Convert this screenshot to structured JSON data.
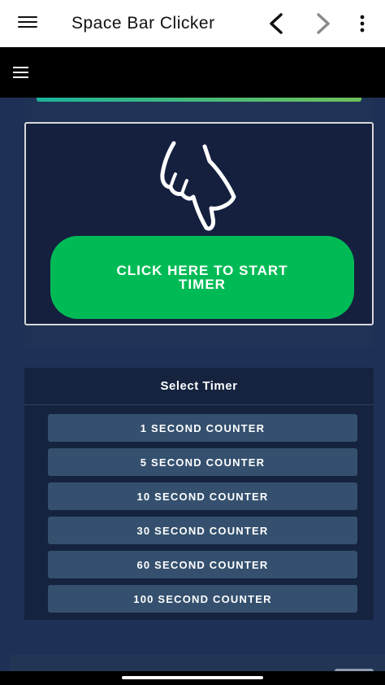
{
  "app_bar": {
    "title": "Space Bar Clicker",
    "menu_icon": "hamburger-menu-icon",
    "back_icon": "chevron-left-icon",
    "forward_icon": "chevron-right-icon",
    "more_icon": "more-vertical-icon"
  },
  "site_nav": {
    "menu_icon": "hamburger-menu-icon"
  },
  "clicker": {
    "hand_icon": "pointing-hand-icon",
    "start_button_label": "CLICK HERE TO START TIMER"
  },
  "timer_select": {
    "heading": "Select Timer",
    "options": [
      "1 SECOND COUNTER",
      "5 SECOND COUNTER",
      "10 SECOND COUNTER",
      "30 SECOND COUNTER",
      "60 SECOND COUNTER",
      "100 SECOND COUNTER"
    ]
  },
  "colors": {
    "background": "#1e3056",
    "start_button": "#00bb55",
    "timer_button": "#34506e",
    "accent_gradient_start": "#1bb39b",
    "accent_gradient_end": "#6fc15a"
  }
}
